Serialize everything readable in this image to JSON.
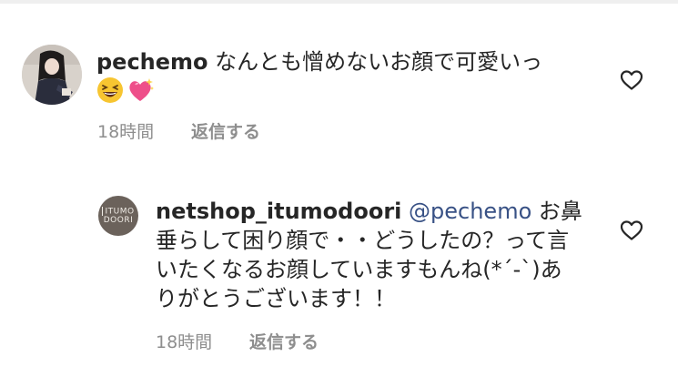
{
  "comments": [
    {
      "username": "pechemo",
      "text": " なんとも憎めないお顔で可愛いっ",
      "emojis": [
        "grinning-squinting-face",
        "sparkling-heart"
      ],
      "time": "18時間",
      "reply_label": "返信する"
    },
    {
      "username": "netshop_itumodoori",
      "mention": "@pechemo",
      "text": " お鼻垂らして困り顔で・・どうしたの？って言いたくなるお顔していますもんね(*´-`)ありがとうございます！！",
      "time": "18時間",
      "reply_label": "返信する",
      "avatar_logo": [
        "ITUMO",
        "DOORI"
      ]
    }
  ],
  "colors": {
    "text": "#262626",
    "meta": "#8e8e8e",
    "mention": "#385185",
    "heart_outline": "#262626"
  },
  "icons": {
    "like": "heart-outline-icon"
  }
}
